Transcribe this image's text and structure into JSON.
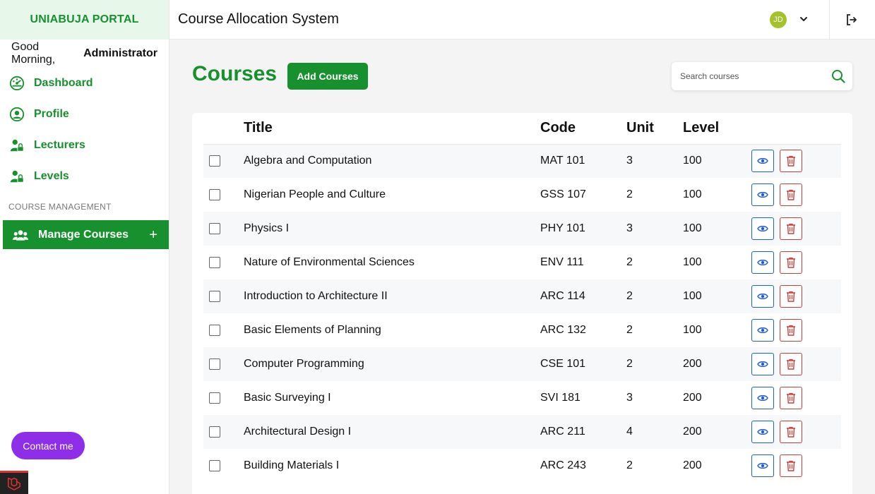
{
  "sidebar": {
    "brand": "UNIABUJA PORTAL",
    "greeting_prefix": "Good Morning,",
    "greeting_name": "Administrator",
    "items": [
      {
        "label": "Dashboard",
        "icon": "dashboard-icon"
      },
      {
        "label": "Profile",
        "icon": "user-circle-icon"
      },
      {
        "label": "Lecturers",
        "icon": "user-lock-icon"
      },
      {
        "label": "Levels",
        "icon": "user-lock-icon"
      }
    ],
    "section_label": "COURSE MANAGEMENT",
    "active_item": {
      "label": "Manage Courses",
      "icon": "users-icon",
      "expand": "+"
    },
    "contact_label": "Contact me"
  },
  "topbar": {
    "title": "Course Allocation System",
    "avatar_initials": "JD"
  },
  "main": {
    "title": "Courses",
    "add_label": "Add Courses",
    "search_placeholder": "Search courses",
    "table": {
      "headers": [
        "Title",
        "Code",
        "Unit",
        "Level"
      ],
      "rows": [
        {
          "title": "Algebra and Computation",
          "code": "MAT 101",
          "unit": "3",
          "level": "100"
        },
        {
          "title": "Nigerian People and Culture",
          "code": "GSS 107",
          "unit": "2",
          "level": "100"
        },
        {
          "title": "Physics I",
          "code": "PHY 101",
          "unit": "3",
          "level": "100"
        },
        {
          "title": "Nature of Environmental Sciences",
          "code": "ENV 111",
          "unit": "2",
          "level": "100"
        },
        {
          "title": "Introduction to Architecture II",
          "code": "ARC 114",
          "unit": "2",
          "level": "100"
        },
        {
          "title": "Basic Elements of Planning",
          "code": "ARC 132",
          "unit": "2",
          "level": "100"
        },
        {
          "title": "Computer Programming",
          "code": "CSE 101",
          "unit": "2",
          "level": "200"
        },
        {
          "title": "Basic Surveying I",
          "code": "SVI 181",
          "unit": "3",
          "level": "200"
        },
        {
          "title": "Architectural Design I",
          "code": "ARC 211",
          "unit": "4",
          "level": "200"
        },
        {
          "title": "Building Materials I",
          "code": "ARC 243",
          "unit": "2",
          "level": "200"
        }
      ]
    }
  },
  "colors": {
    "brand_green": "#17912e",
    "brand_bg": "#e7f8ea",
    "contact_purple": "#8e2ee8",
    "view_blue": "#1e5fc8",
    "delete_red": "#d23a2f"
  }
}
